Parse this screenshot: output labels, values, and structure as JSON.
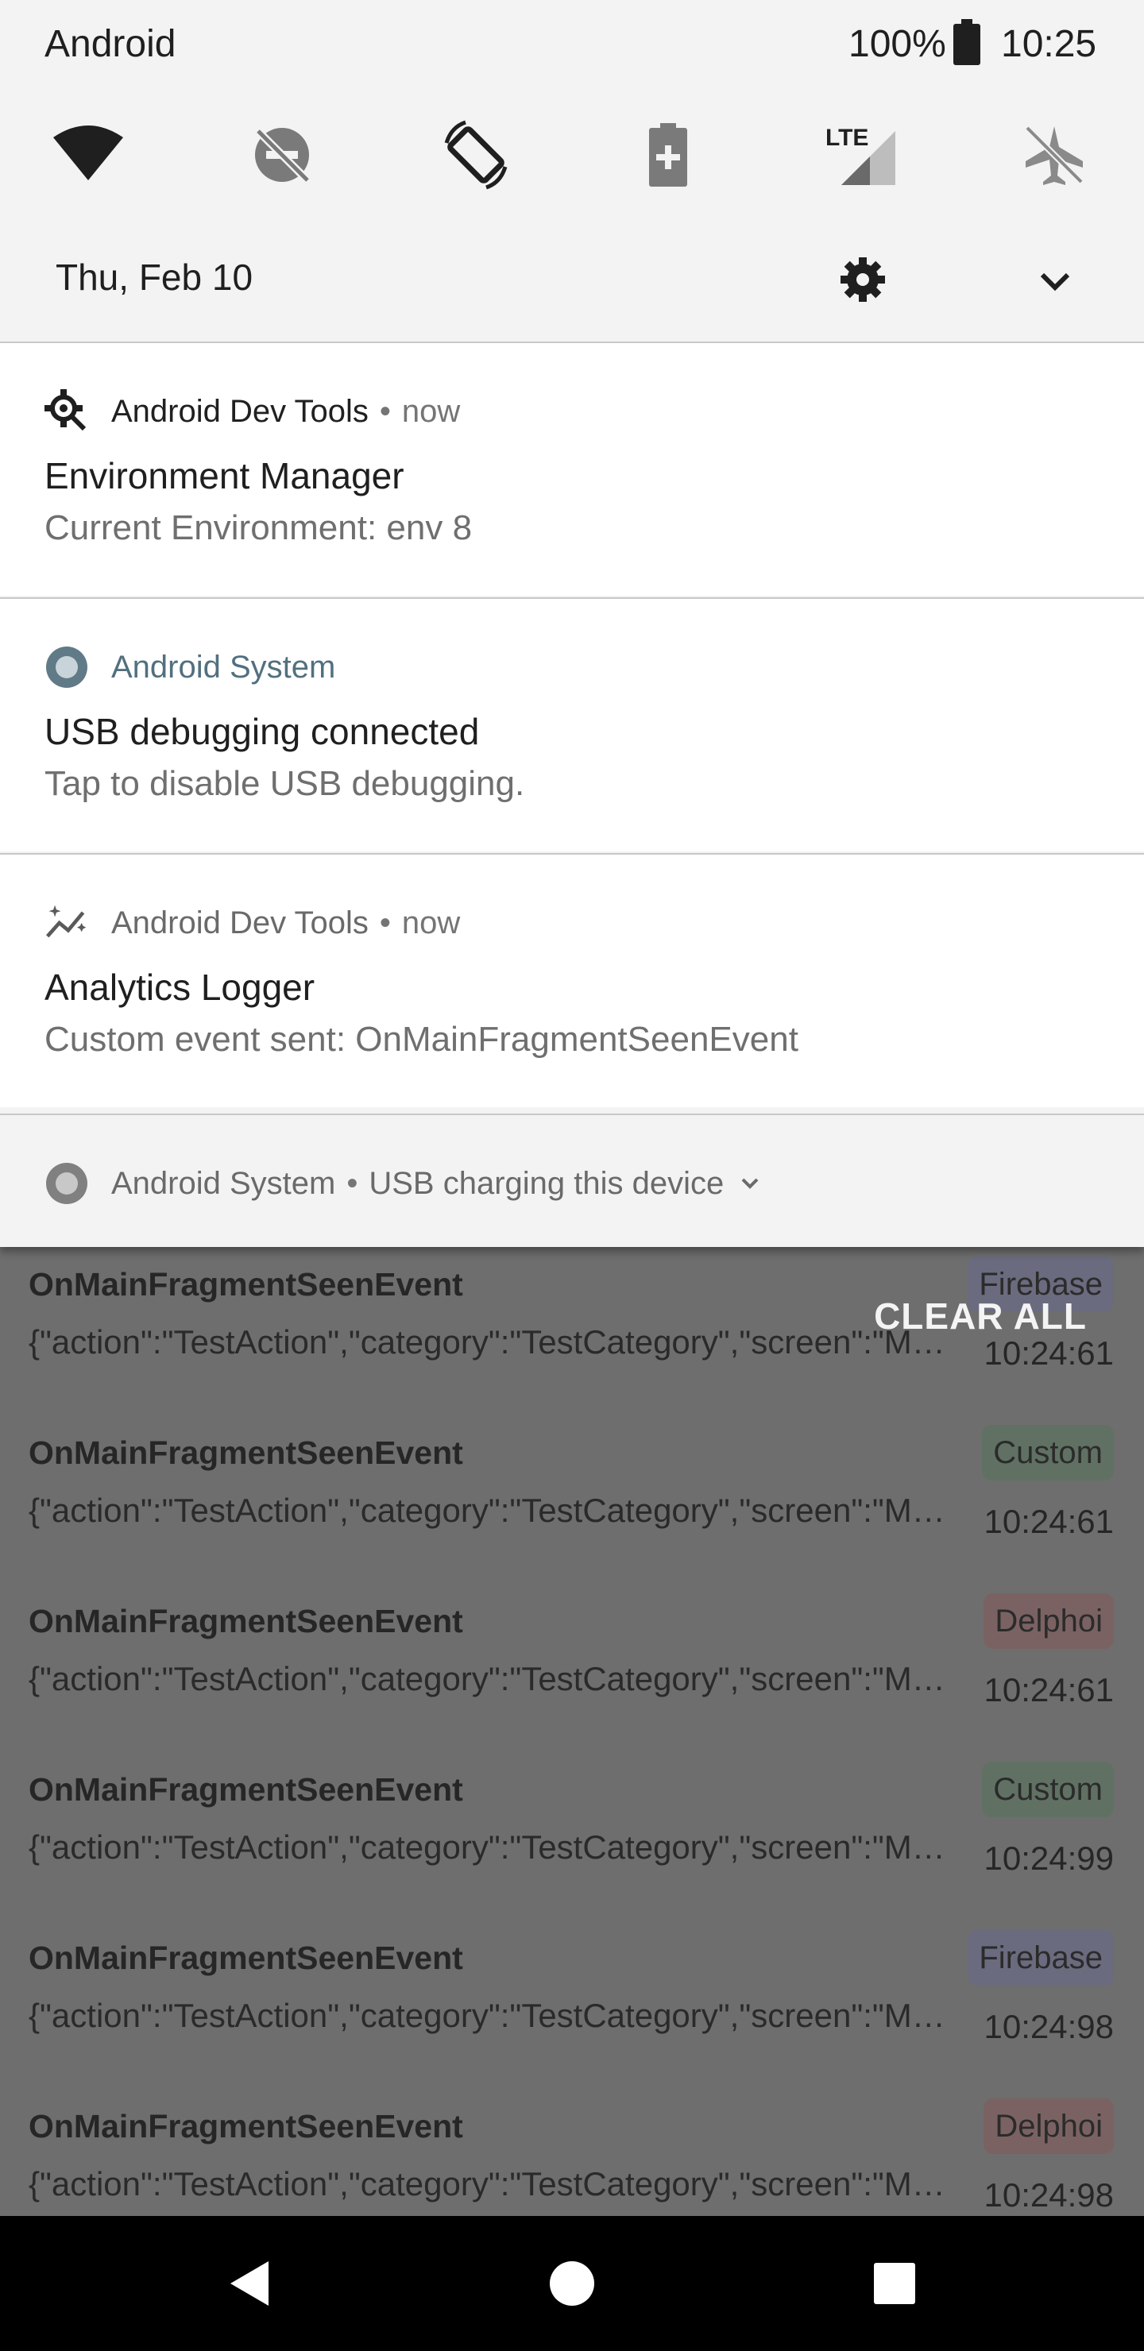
{
  "status_bar": {
    "carrier": "Android",
    "battery_percent": "100%",
    "time": "10:25"
  },
  "quick_settings": {
    "icons": [
      "wifi-icon",
      "do-not-disturb-off-icon",
      "auto-rotate-icon",
      "battery-saver-icon",
      "lte-signal-icon",
      "airplane-mode-icon"
    ],
    "date": "Thu, Feb 10"
  },
  "notifications": [
    {
      "app": "Android Dev Tools",
      "separator": "•",
      "time": "now",
      "title": "Environment Manager",
      "text": "Current Environment: env 8",
      "icon": "gear-search-icon"
    },
    {
      "app": "Android System",
      "separator": "",
      "time": "",
      "title": "USB debugging connected",
      "text": "Tap to disable USB debugging.",
      "icon": "android-system-icon"
    },
    {
      "app": "Android Dev Tools",
      "separator": "•",
      "time": "now",
      "title": "Analytics Logger",
      "text": "Custom event sent: OnMainFragmentSeenEvent",
      "icon": "analytics-sparkle-icon"
    }
  ],
  "collapsed_notification": {
    "app": "Android System",
    "separator": "•",
    "text": "USB charging this device",
    "icon": "android-system-icon"
  },
  "background_app": {
    "clear_all_label": "CLEAR ALL",
    "events": [
      {
        "name": "OnMainFragmentSeenEvent",
        "payload": "{\"action\":\"TestAction\",\"category\":\"TestCategory\",\"screen\":\"MainFragment\"}",
        "badge": "Firebase",
        "time": "10:24:61"
      },
      {
        "name": "OnMainFragmentSeenEvent",
        "payload": "{\"action\":\"TestAction\",\"category\":\"TestCategory\",\"screen\":\"MainFragment\"}",
        "badge": "Custom",
        "time": "10:24:61"
      },
      {
        "name": "OnMainFragmentSeenEvent",
        "payload": "{\"action\":\"TestAction\",\"category\":\"TestCategory\",\"screen\":\"MainFragment\"}",
        "badge": "Delphoi",
        "time": "10:24:61"
      },
      {
        "name": "OnMainFragmentSeenEvent",
        "payload": "{\"action\":\"TestAction\",\"category\":\"TestCategory\",\"screen\":\"MainFragment\"}",
        "badge": "Custom",
        "time": "10:24:99"
      },
      {
        "name": "OnMainFragmentSeenEvent",
        "payload": "{\"action\":\"TestAction\",\"category\":\"TestCategory\",\"screen\":\"MainFragment\"}",
        "badge": "Firebase",
        "time": "10:24:98"
      },
      {
        "name": "OnMainFragmentSeenEvent",
        "payload": "{\"action\":\"TestAction\",\"category\":\"TestCategory\",\"screen\":\"MainFragment\"}",
        "badge": "Delphoi",
        "time": "10:24:98"
      }
    ],
    "badge_colors": {
      "Firebase": "#6a6b7e",
      "Custom": "#607163",
      "Delphoi": "#7b6262"
    }
  },
  "navigation_bar": {
    "buttons": [
      "back-icon",
      "home-icon",
      "recents-icon"
    ]
  }
}
